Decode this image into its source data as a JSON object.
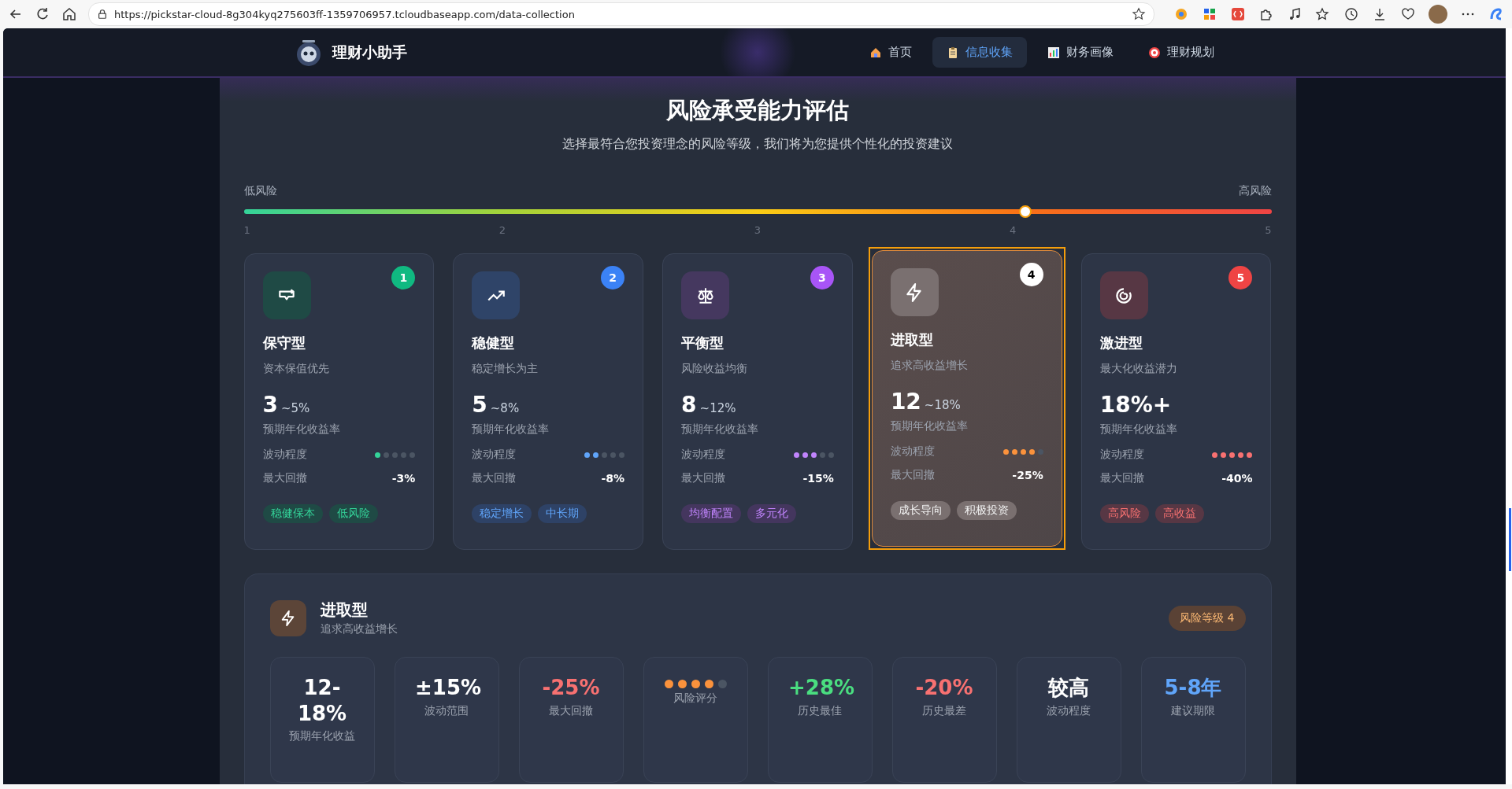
{
  "browser": {
    "url": "https://pickstar-cloud-8g304kyq275603ff-1359706957.tcloudbaseapp.com/data-collection"
  },
  "nav": {
    "brand": "理财小助手",
    "items": [
      {
        "label": "首页",
        "selected": false
      },
      {
        "label": "信息收集",
        "selected": true
      },
      {
        "label": "财务画像",
        "selected": false
      },
      {
        "label": "理财规划",
        "selected": false
      }
    ]
  },
  "header": {
    "title": "风险承受能力评估",
    "subtitle": "选择最符合您投资理念的风险等级，我们将为您提供个性化的投资建议"
  },
  "risk_scale": {
    "low_label": "低风险",
    "high_label": "高风险",
    "level": 0.76,
    "ticks": [
      "1",
      "2",
      "3",
      "4",
      "5"
    ]
  },
  "cards": [
    {
      "number": "1",
      "name": "保守型",
      "tagline": "资本保值优先",
      "return_main": "3",
      "return_suffix": "~5%",
      "return_label": "预期年化收益率",
      "volatility_label": "波动程度",
      "stars": 1,
      "drawdown_label": "最大回撤",
      "drawdown": "-3%",
      "tags": [
        "稳健保本",
        "低风险"
      ],
      "color": "#10b981",
      "selected": false
    },
    {
      "number": "2",
      "name": "稳健型",
      "tagline": "稳定增长为主",
      "return_main": "5",
      "return_suffix": "~8%",
      "return_label": "预期年化收益率",
      "volatility_label": "波动程度",
      "stars": 2,
      "drawdown_label": "最大回撤",
      "drawdown": "-8%",
      "tags": [
        "稳定增长",
        "中长期"
      ],
      "color": "#3b82f6",
      "selected": false
    },
    {
      "number": "3",
      "name": "平衡型",
      "tagline": "风险收益均衡",
      "return_main": "8",
      "return_suffix": "~12%",
      "return_label": "预期年化收益率",
      "volatility_label": "波动程度",
      "stars": 3,
      "drawdown_label": "最大回撤",
      "drawdown": "-15%",
      "tags": [
        "均衡配置",
        "多元化"
      ],
      "color": "#a855f7",
      "selected": false
    },
    {
      "number": "4",
      "name": "进取型",
      "tagline": "追求高收益增长",
      "return_main": "12",
      "return_suffix": "~18%",
      "return_label": "预期年化收益率",
      "volatility_label": "波动程度",
      "stars": 4,
      "drawdown_label": "最大回撤",
      "drawdown": "-25%",
      "tags": [
        "成长导向",
        "积极投资"
      ],
      "color": "#f59e0b",
      "selected": true
    },
    {
      "number": "5",
      "name": "激进型",
      "tagline": "最大化收益潜力",
      "return_main": "18%+",
      "return_label": "预期年化收益率",
      "volatility_label": "波动程度",
      "stars": 5,
      "drawdown_label": "最大回撤",
      "drawdown": "-40%",
      "tags": [
        "高风险",
        "高收益"
      ],
      "color": "#ef4444",
      "selected": false
    }
  ],
  "detail": {
    "name": "进取型",
    "tagline": "追求高收益增长",
    "badge": "风险等级 4",
    "stats": [
      {
        "kind": "value",
        "value": "12-18%",
        "label": "预期年化收益",
        "color": "#ffffff"
      },
      {
        "kind": "value",
        "value": "±15%",
        "label": "波动范围",
        "color": "#ffffff"
      },
      {
        "kind": "value",
        "value": "-25%",
        "label": "最大回撤",
        "color": "#f87171"
      },
      {
        "kind": "dots",
        "stars": 4,
        "label": "风险评分"
      },
      {
        "kind": "value",
        "value": "+28%",
        "label": "历史最佳",
        "color": "#4ade80"
      },
      {
        "kind": "value",
        "value": "-20%",
        "label": "历史最差",
        "color": "#f87171"
      },
      {
        "kind": "value",
        "value": "较高",
        "label": "波动程度",
        "color": "#ffffff"
      },
      {
        "kind": "value",
        "value": "5-8年",
        "label": "建议期限",
        "color": "#60a5fa"
      }
    ]
  }
}
